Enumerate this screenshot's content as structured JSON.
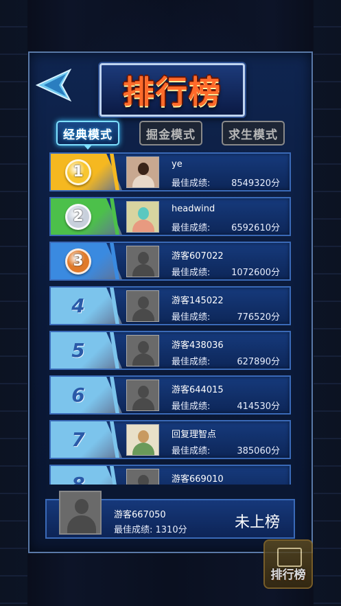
{
  "title": "排行榜",
  "tabs": [
    {
      "label": "经典模式",
      "active": true
    },
    {
      "label": "掘金模式",
      "active": false
    },
    {
      "label": "求生模式",
      "active": false
    }
  ],
  "score_label": "最佳成绩:",
  "rows": [
    {
      "rank": "1",
      "name": "ye",
      "score": "8549320分",
      "badge": "gold"
    },
    {
      "rank": "2",
      "name": "headwind",
      "score": "6592610分",
      "badge": "silver"
    },
    {
      "rank": "3",
      "name": "游客607022",
      "score": "1072600分",
      "badge": "bronze"
    },
    {
      "rank": "4",
      "name": "游客145022",
      "score": "776520分",
      "badge": "plain"
    },
    {
      "rank": "5",
      "name": "游客438036",
      "score": "627890分",
      "badge": "plain"
    },
    {
      "rank": "6",
      "name": "游客644015",
      "score": "414530分",
      "badge": "plain"
    },
    {
      "rank": "7",
      "name": "回复理智点",
      "score": "385060分",
      "badge": "plain"
    },
    {
      "rank": "8",
      "name": "游客669010",
      "score": "",
      "badge": "plain"
    }
  ],
  "me": {
    "name": "游客667050",
    "score_line": "最佳成绩:  1310分",
    "status": "未上榜"
  },
  "corner_button": "排行榜",
  "colors": {
    "gold": "#f5b820",
    "silver": "#4cc04a",
    "bronze": "#3a8ae0",
    "plain": "#7cc4ec",
    "accent": "#7fe0ff"
  }
}
